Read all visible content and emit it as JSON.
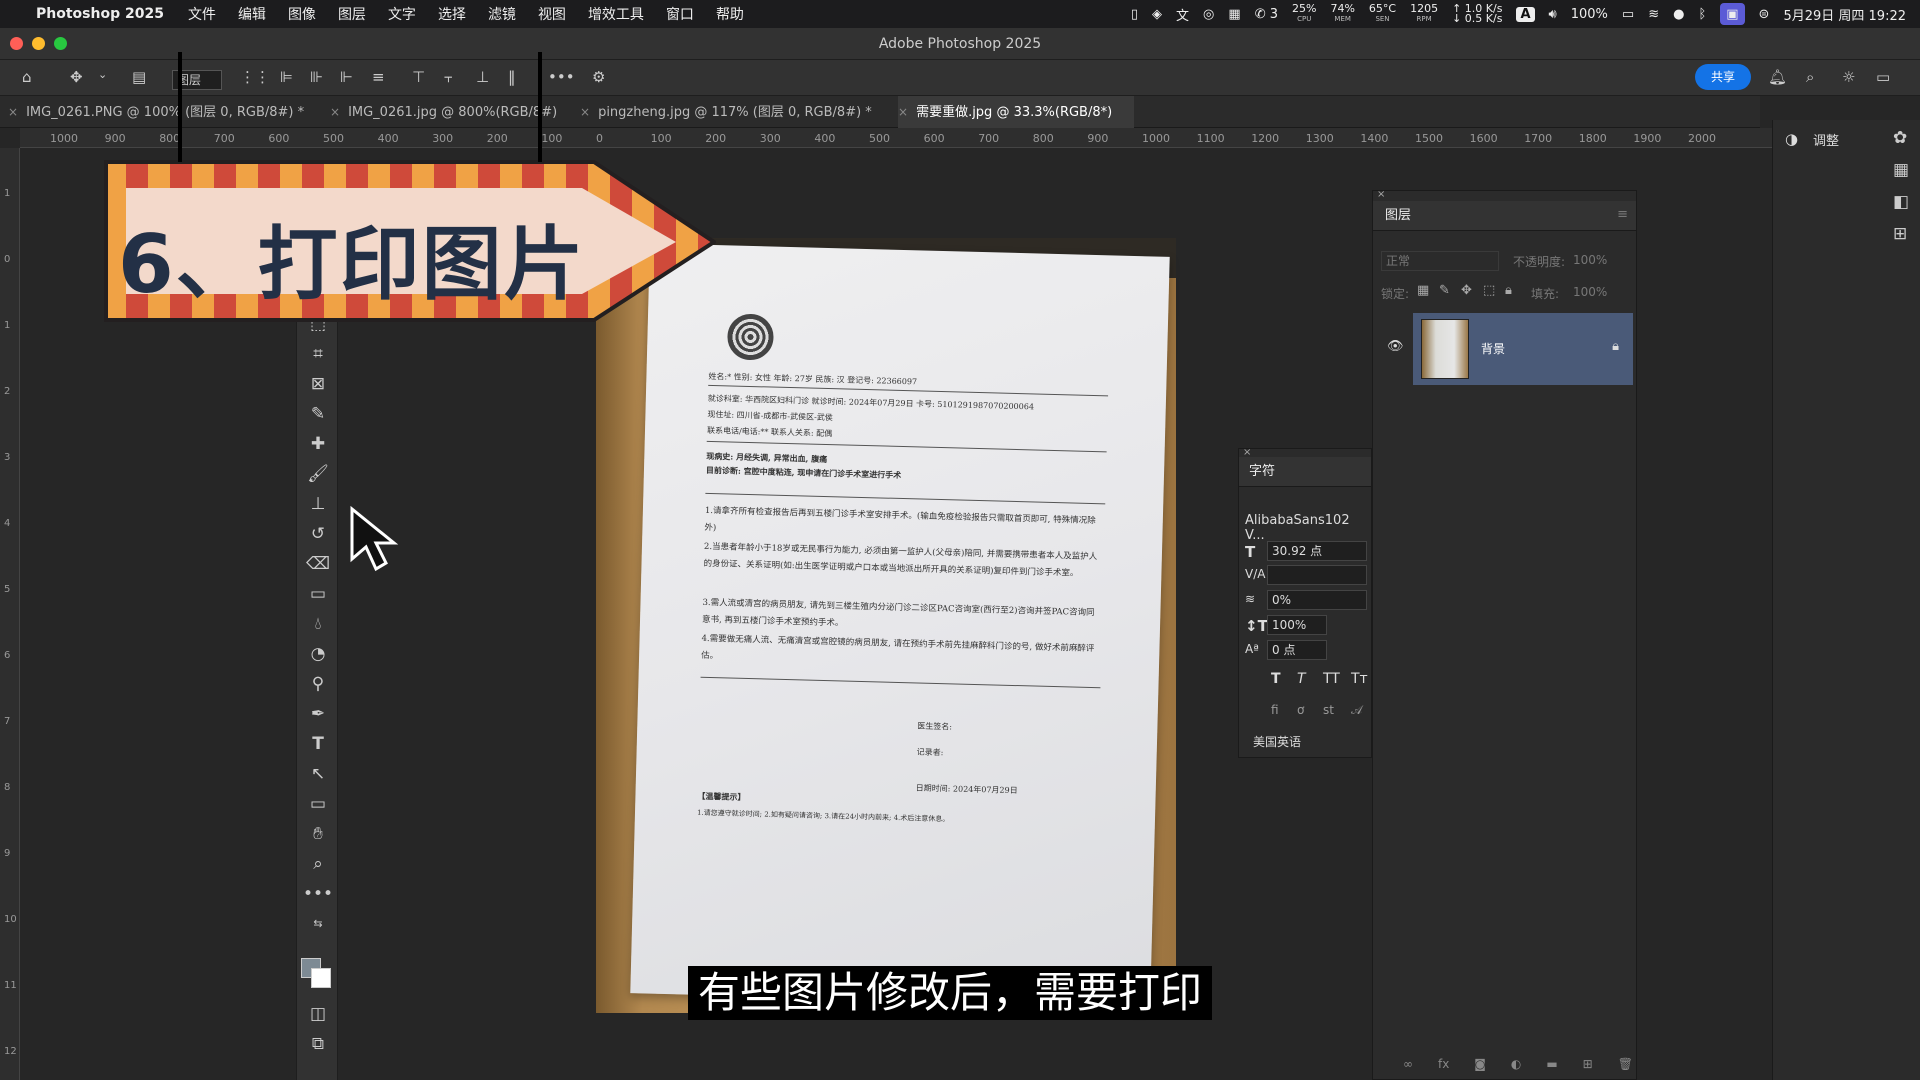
{
  "menubar": {
    "app": "Photoshop 2025",
    "items": [
      "文件",
      "编辑",
      "图像",
      "图层",
      "文字",
      "选择",
      "滤镜",
      "视图",
      "增效工具",
      "窗口",
      "帮助"
    ],
    "wechat_count": "3",
    "cpu": {
      "value": "25%",
      "label": "CPU"
    },
    "mem": {
      "value": "74%",
      "label": "MEM"
    },
    "sen": {
      "value": "65°C",
      "label": "SEN"
    },
    "rpm": {
      "value": "1205",
      "label": "RPM"
    },
    "net_up": "↑ 1.0 K/s",
    "net_down": "↓ 0.5 K/s",
    "input_method": "A",
    "battery": "100%",
    "datetime": "5月29日 周四  19:22"
  },
  "window": {
    "title": "Adobe Photoshop 2025"
  },
  "optbar": {
    "layer_select": "图层",
    "share": "共享"
  },
  "tabs": [
    {
      "label": "IMG_0261.PNG @ 100% (图层 0, RGB/8#) *"
    },
    {
      "label": "IMG_0261.jpg @ 800%(RGB/8#)"
    },
    {
      "label": "pingzheng.jpg @ 117% (图层 0, RGB/8#) *"
    },
    {
      "label": "需要重做.jpg @ 33.3%(RGB/8*)"
    }
  ],
  "ruler": {
    "h": [
      "1000",
      "900",
      "800",
      "700",
      "600",
      "500",
      "400",
      "300",
      "200",
      "100",
      "0",
      "100",
      "200",
      "300",
      "400",
      "500",
      "600",
      "700",
      "800",
      "900",
      "1000",
      "1100",
      "1200",
      "1300",
      "1400",
      "1500",
      "1600",
      "1700",
      "1800",
      "1900",
      "2000"
    ],
    "v": [
      "1",
      "0",
      "1",
      "2",
      "3",
      "4",
      "5",
      "6",
      "7",
      "8",
      "9",
      "10",
      "11",
      "12"
    ]
  },
  "banner": {
    "text": "6、打印图片"
  },
  "document": {
    "row1": "姓名:*          性别: 女性          年龄: 27岁          民族: 汉          登记号: 22366097",
    "row2": "就诊科室: 华西院区妇科门诊      就诊时间: 2024年07月29日      卡号: 5101291987070200064",
    "row3": "现住址: 四川省-成都市-武侯区-武侯",
    "row4": "联系电话/电话:**                                                           联系人关系: 配偶",
    "row5": "现病史: 月经失调, 异常出血, 腹痛",
    "row6": "目前诊断: 宫腔中度粘连, 现申请在门诊手术室进行手术",
    "p1": "1.请拿齐所有检查报告后再到五楼门诊手术室安排手术。(输血免疫检验报告只需取首页即可, 特殊情况除外)",
    "p2": "2.当患者年龄小于18岁或无民事行为能力, 必须由第一监护人(父母亲)陪同, 并需要携带患者本人及监护人的身份证、关系证明(如:出生医学证明或户口本或当地派出所开具的关系证明)复印件到门诊手术室。",
    "p3": "3.需人流或清宫的病员朋友, 请先到三楼生殖内分泌门诊二诊区PAC咨询室(西行至2)咨询并签PAC咨询同意书, 再到五楼门诊手术室预约手术。",
    "p4": "4.需要做无痛人流、无痛清宫或宫腔镜的病员朋友, 请在预约手术前先挂麻醉科门诊的号, 做好术前麻醉评估。",
    "doctor": "医生签名:",
    "recorder": "记录者:",
    "date": "日期时间: 2024年07月29日",
    "tips_title": "【温馨提示】",
    "tips": "1.请您遵守就诊时间; 2.如有疑问请咨询; 3.请在24小时内前来; 4.术后注意休息。"
  },
  "layers_panel": {
    "title": "图层",
    "blend": "正常",
    "opacity_label": "不透明度:",
    "opacity": "100%",
    "lock_label": "锁定:",
    "fill_label": "填充:",
    "fill": "100%",
    "layer_name": "背景"
  },
  "char_panel": {
    "title": "字符",
    "font": "AlibabaSans102 V...",
    "size": "30.92 点",
    "tracking": "0%",
    "vscale": "100%",
    "baseline": "0 点",
    "language": "美国英语"
  },
  "dock": {
    "adjust": "调整"
  },
  "subtitle": "有些图片修改后，需要打印",
  "colors": {
    "accent": "#1473e6",
    "banner_red": "#cf4a3a",
    "banner_orange": "#f0a245",
    "banner_fill": "#f3d9cb",
    "banner_text": "#233046"
  }
}
